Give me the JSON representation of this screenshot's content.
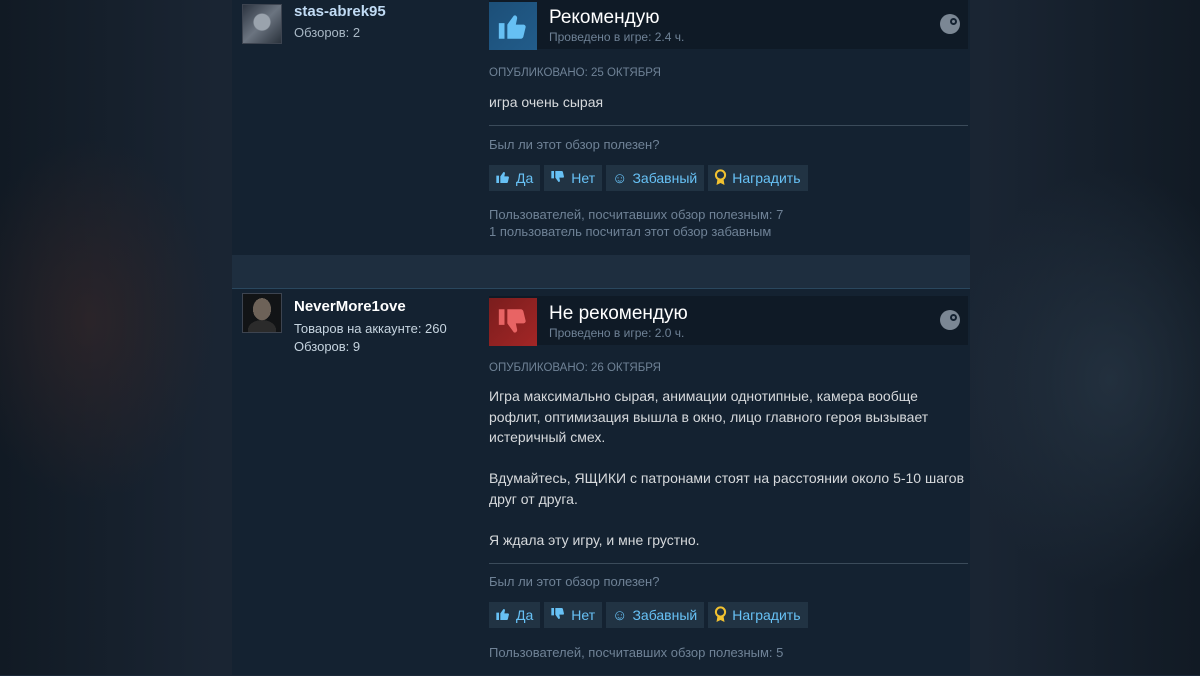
{
  "reviews": [
    {
      "author": {
        "name": "stas-abrek95",
        "lines": [
          "Обзоров: 2"
        ]
      },
      "vote": "Рекомендую",
      "recommended": true,
      "playtime": "Проведено в игре: 2.4 ч.",
      "posted": "Опубликовано: 25 октября",
      "body": [
        "игра очень сырая"
      ],
      "helpful_question": "Был ли этот обзор полезен?",
      "buttons": {
        "yes": "Да",
        "no": "Нет",
        "funny": "Забавный",
        "award": "Наградить"
      },
      "stats": [
        "Пользователей, посчитавших обзор полезным: 7",
        "1 пользователь посчитал этот обзор забавным"
      ]
    },
    {
      "author": {
        "name": "NeverMore1ove",
        "lines": [
          "Товаров на аккаунте: 260",
          "Обзоров: 9"
        ]
      },
      "vote": "Не рекомендую",
      "recommended": false,
      "playtime": "Проведено в игре: 2.0 ч.",
      "posted": "Опубликовано: 26 октября",
      "body": [
        "Игра максимально сырая, анимации однотипные, камера вообще рофлит, оптимизация вышла в окно, лицо главного героя вызывает истеричный смех.",
        "Вдумайтесь, ЯЩИКИ с патронами стоят на расстоянии около 5-10 шагов друг от друга.",
        "Я ждала эту игру, и мне грустно."
      ],
      "helpful_question": "Был ли этот обзор полезен?",
      "buttons": {
        "yes": "Да",
        "no": "Нет",
        "funny": "Забавный",
        "award": "Наградить"
      },
      "stats": [
        "Пользователей, посчитавших обзор полезным: 5"
      ]
    }
  ],
  "colors": {
    "recommend": "#225c8a",
    "not_recommend": "#a32626",
    "link": "#67c1f5",
    "award": "#f2c230"
  },
  "icons": {
    "thumbs_up": "thumbs-up-icon",
    "thumbs_down": "thumbs-down-icon",
    "funny": "smile-icon",
    "award": "award-icon",
    "platform": "steam-icon"
  }
}
